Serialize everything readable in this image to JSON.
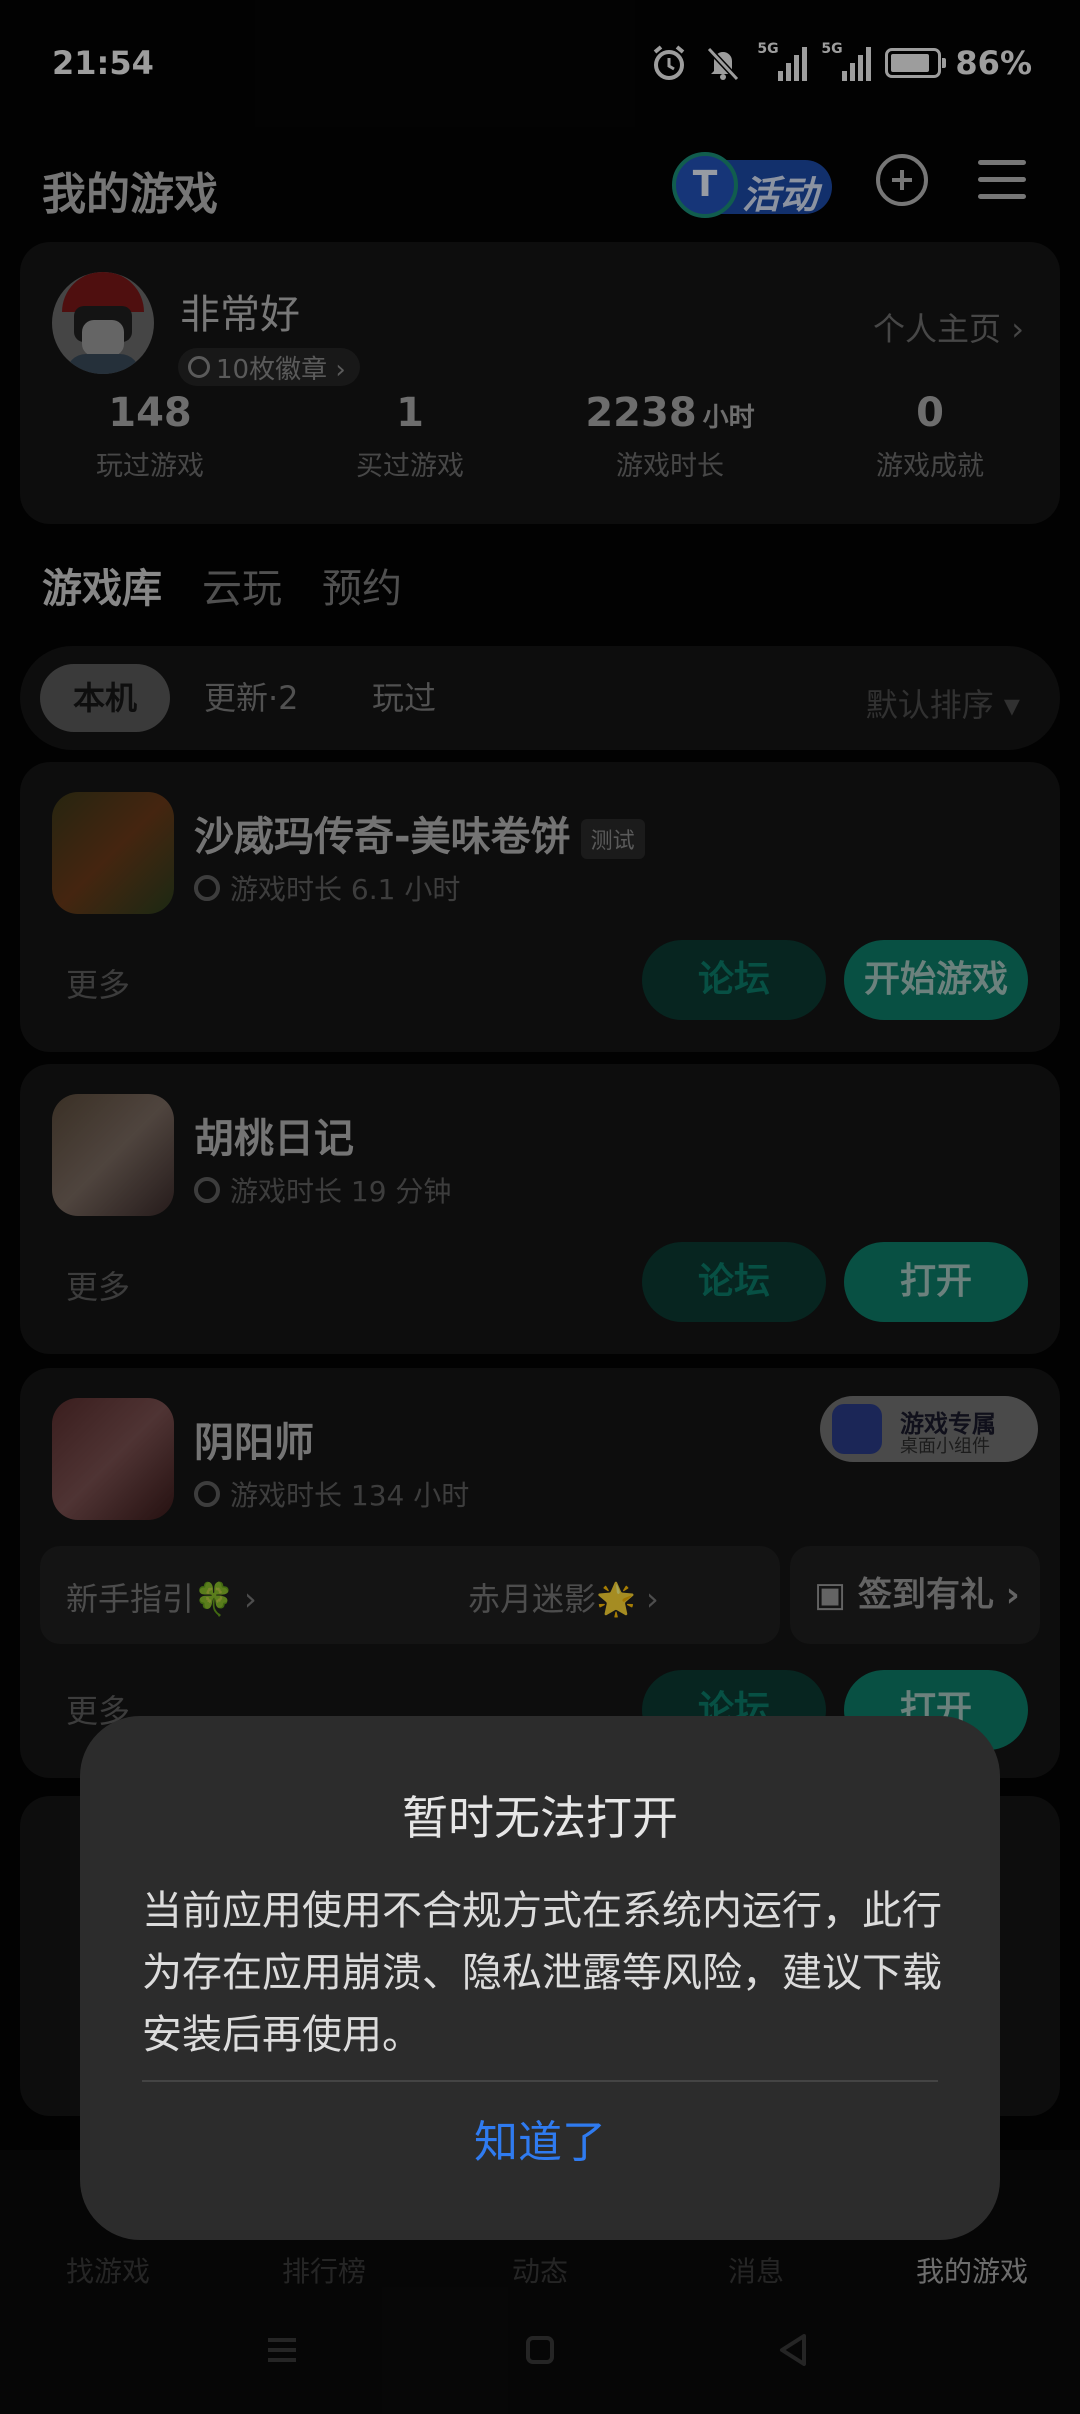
{
  "status_bar": {
    "time": "21:54",
    "network1": "5G",
    "network2": "5G",
    "battery_pct": "86%",
    "battery_level": 0.86
  },
  "header": {
    "title": "我的游戏",
    "activity_label": "活动"
  },
  "profile": {
    "username": "非常好",
    "medals": "10枚徽章 ›",
    "homepage_link": "个人主页 ›",
    "stats": [
      {
        "value": "148",
        "unit": "",
        "label": "玩过游戏"
      },
      {
        "value": "1",
        "unit": "",
        "label": "买过游戏"
      },
      {
        "value": "2238",
        "unit": "小时",
        "label": "游戏时长"
      },
      {
        "value": "0",
        "unit": "",
        "label": "游戏成就"
      }
    ]
  },
  "tabs": [
    "游戏库",
    "云玩",
    "预约"
  ],
  "filters": {
    "chips": [
      "本机",
      "更新·2",
      "玩过"
    ],
    "sort": "默认排序 ▾"
  },
  "games": [
    {
      "name": "沙威玛传奇-美味卷饼",
      "tag": "测试",
      "playtime": "游戏时长 6.1 小时",
      "more": "更多",
      "forum": "论坛",
      "action": "开始游戏"
    },
    {
      "name": "胡桃日记",
      "tag": "",
      "playtime": "游戏时长 19 分钟",
      "more": "更多",
      "forum": "论坛",
      "action": "打开"
    },
    {
      "name": "阴阳师",
      "tag": "",
      "playtime": "游戏时长 134 小时",
      "more": "更多",
      "forum": "论坛",
      "action": "打开",
      "widget_title": "游戏专属",
      "widget_sub": "桌面小组件",
      "links": [
        "新手指引🍀 ›",
        "赤月迷影🌟 ›"
      ],
      "checkin": "签到有礼 ›"
    }
  ],
  "bottom_nav": [
    "找游戏",
    "排行榜",
    "动态",
    "消息",
    "我的游戏"
  ],
  "dialog": {
    "title": "暂时无法打开",
    "body": "当前应用使用不合规方式在系统内运行，此行为存在应用崩溃、隐私泄露等风险，建议下载安装后再使用。",
    "button": "知道了"
  },
  "colors": {
    "accent": "#0d7c68",
    "dialog_button": "#2f7bf0",
    "dialog_bg": "#2c2c2c"
  }
}
